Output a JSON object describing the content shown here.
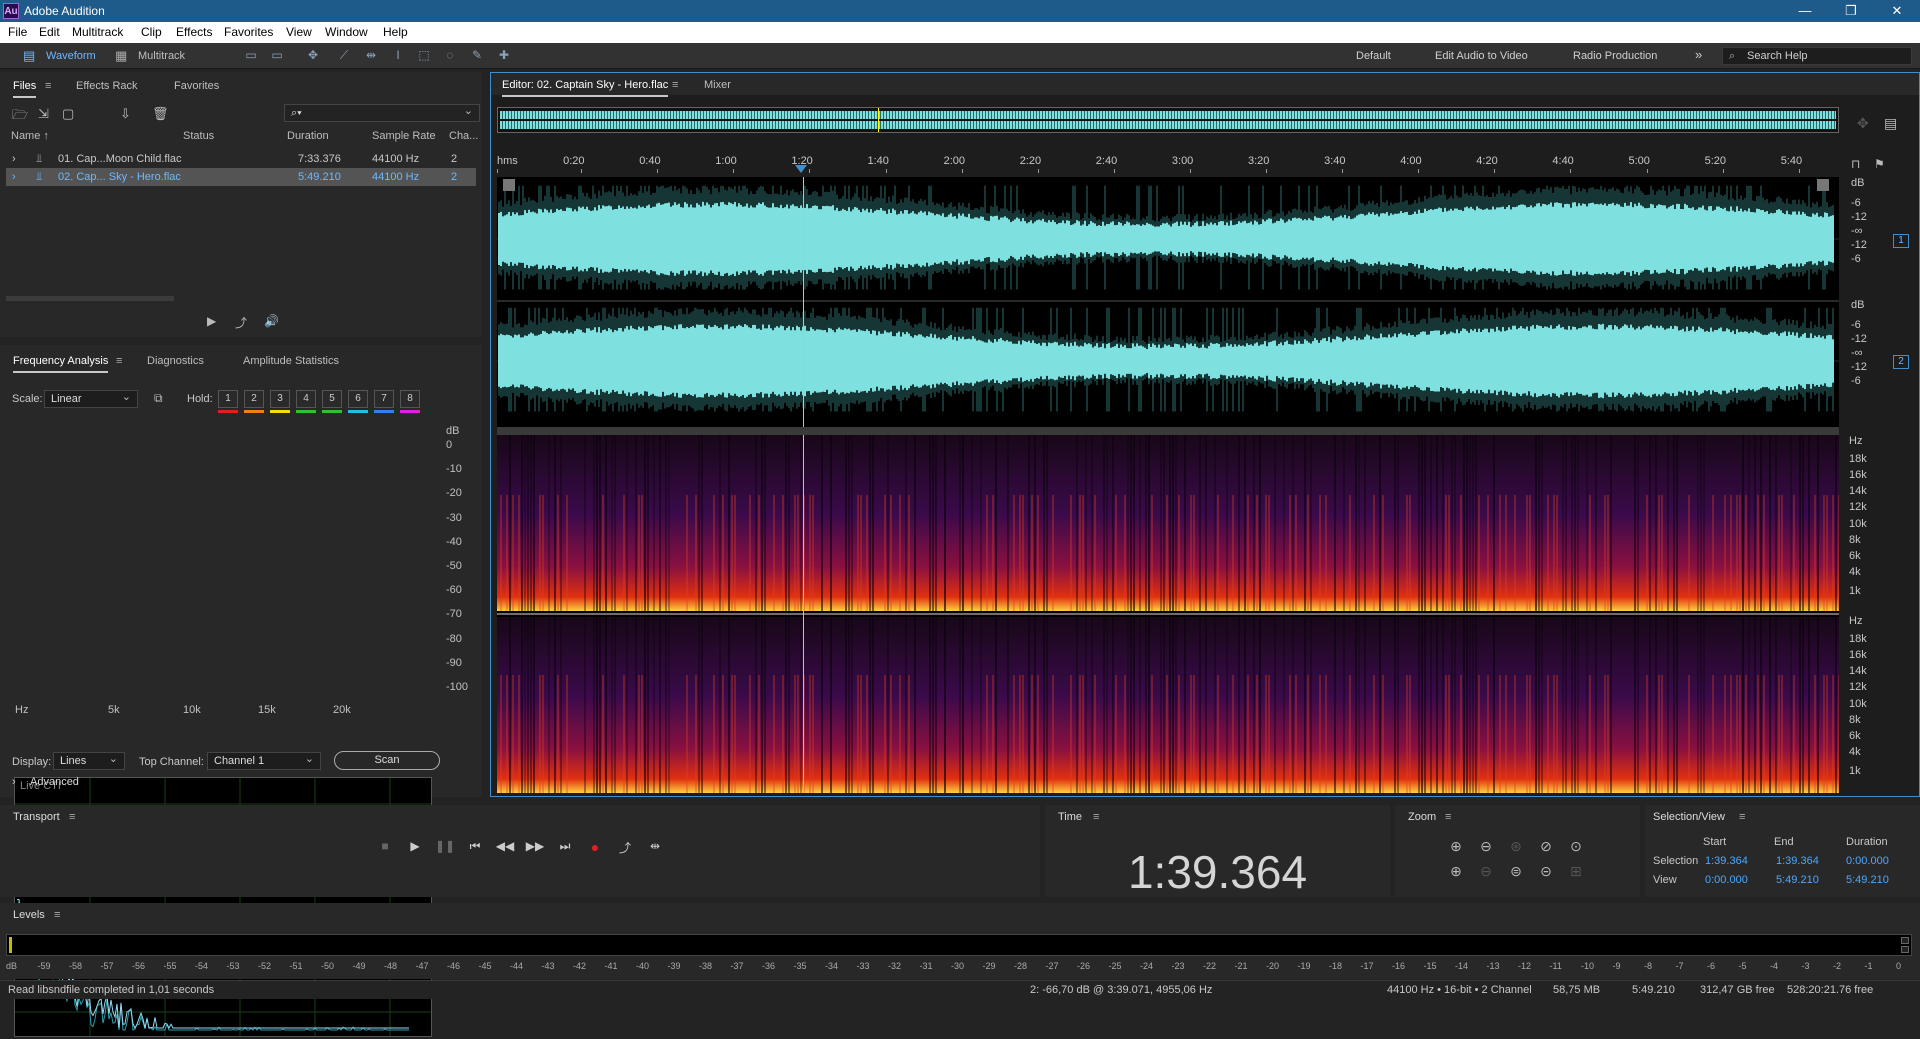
{
  "app": {
    "title": "Adobe Audition",
    "logo": "Au"
  },
  "menu": [
    "File",
    "Edit",
    "Multitrack",
    "Clip",
    "Effects",
    "Favorites",
    "View",
    "Window",
    "Help"
  ],
  "toolbar": {
    "waveform": "Waveform",
    "multitrack": "Multitrack",
    "workspaces": [
      "Default",
      "Edit Audio to Video",
      "Radio Production"
    ],
    "overflow": "»",
    "search_placeholder": "Search Help"
  },
  "files": {
    "tabs": [
      "Files",
      "Effects Rack",
      "Favorites"
    ],
    "columns": [
      "Name ↑",
      "Status",
      "Duration",
      "Sample Rate",
      "Cha..."
    ],
    "rows": [
      {
        "name": "01. Cap...Moon Child.flac",
        "duration": "7:33.376",
        "rate": "44100 Hz",
        "ch": "2"
      },
      {
        "name": "02. Cap... Sky - Hero.flac",
        "duration": "5:49.210",
        "rate": "44100 Hz",
        "ch": "2"
      }
    ],
    "search_icon": "⌕▾"
  },
  "freq": {
    "tabs": [
      "Frequency Analysis",
      "Diagnostics",
      "Amplitude Statistics"
    ],
    "scale_label": "Scale:",
    "scale": "Linear",
    "hold_label": "Hold:",
    "holds": [
      "1",
      "2",
      "3",
      "4",
      "5",
      "6",
      "7",
      "8"
    ],
    "hold_colors": [
      "#e02020",
      "#f08010",
      "#f0e010",
      "#30c030",
      "#30c030",
      "#20c0e0",
      "#3080f0",
      "#e020e0"
    ],
    "graph_label": "Live CTI",
    "db_label": "dB",
    "db_ticks": [
      "0",
      "-10",
      "-20",
      "-30",
      "-40",
      "-50",
      "-60",
      "-70",
      "-80",
      "-90",
      "-100"
    ],
    "hz_ticks": [
      "Hz",
      "5k",
      "10k",
      "15k",
      "20k"
    ],
    "display_label": "Display:",
    "display": "Lines",
    "top_channel_label": "Top Channel:",
    "top_channel": "Channel 1",
    "scan": "Scan",
    "advanced": "Advanced"
  },
  "editor": {
    "tab": "Editor: 02. Captain Sky - Hero.flac",
    "mixer": "Mixer",
    "ruler": [
      "hms",
      "0:20",
      "0:40",
      "1:00",
      "1:20",
      "1:40",
      "2:00",
      "2:20",
      "2:40",
      "3:00",
      "3:20",
      "3:40",
      "4:00",
      "4:20",
      "4:40",
      "5:00",
      "5:20",
      "5:40"
    ],
    "db_ticks": [
      "dB",
      "-6",
      "-12",
      "-∞",
      "-12",
      "-6"
    ],
    "hz_ticks": [
      "Hz",
      "18k",
      "16k",
      "14k",
      "12k",
      "10k",
      "8k",
      "6k",
      "4k",
      "1k"
    ],
    "ch1": "1",
    "ch2": "2",
    "wave_color": "#7fe0e0"
  },
  "transport": {
    "title": "Transport",
    "buttons": [
      "■",
      "▶",
      "❚❚",
      "⏮",
      "◀◀",
      "▶▶",
      "⏭",
      "●",
      "⤴",
      "⇹"
    ]
  },
  "time": {
    "title": "Time",
    "value": "1:39.364"
  },
  "zoom": {
    "title": "Zoom"
  },
  "selview": {
    "title": "Selection/View",
    "headers": [
      "Start",
      "End",
      "Duration"
    ],
    "selection": [
      "Selection",
      "1:39.364",
      "1:39.364",
      "0:00.000"
    ],
    "view": [
      "View",
      "0:00.000",
      "5:49.210",
      "5:49.210"
    ]
  },
  "levels": {
    "title": "Levels",
    "ticks": [
      "dB",
      "-59",
      "-58",
      "-57",
      "-56",
      "-55",
      "-54",
      "-53",
      "-52",
      "-51",
      "-50",
      "-49",
      "-48",
      "-47",
      "-46",
      "-45",
      "-44",
      "-43",
      "-42",
      "-41",
      "-40",
      "-39",
      "-38",
      "-37",
      "-36",
      "-35",
      "-34",
      "-33",
      "-32",
      "-31",
      "-30",
      "-29",
      "-28",
      "-27",
      "-26",
      "-25",
      "-24",
      "-23",
      "-22",
      "-21",
      "-20",
      "-19",
      "-18",
      "-17",
      "-16",
      "-15",
      "-14",
      "-13",
      "-12",
      "-11",
      "-10",
      "-9",
      "-8",
      "-7",
      "-6",
      "-5",
      "-4",
      "-3",
      "-2",
      "-1",
      "0"
    ]
  },
  "status": {
    "left": "Read libsndfile completed in 1,01 seconds",
    "cursor": "2: -66,70 dB @ 3:39.071, 4955,06 Hz",
    "format": "44100 Hz • 16-bit • 2 Channel",
    "size": "58,75 MB",
    "duration": "5:49.210",
    "free": "312,47 GB free",
    "free_time": "528:20:21.76 free"
  }
}
